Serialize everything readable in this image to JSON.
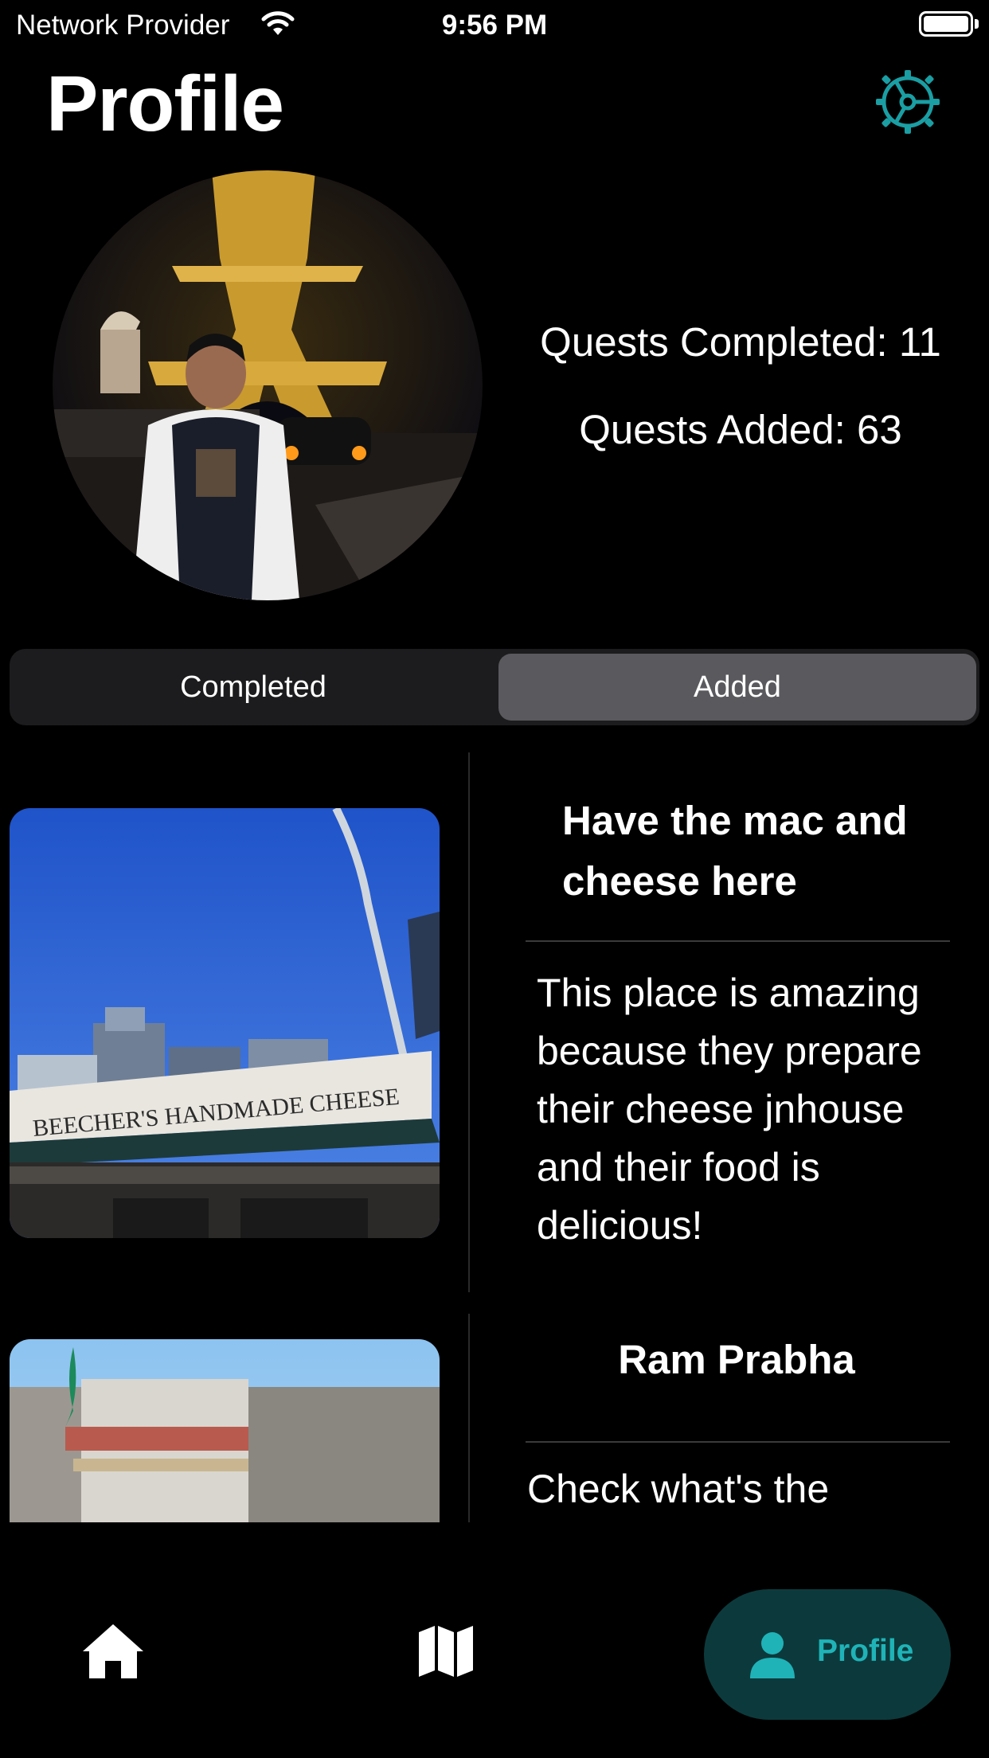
{
  "status_bar": {
    "carrier": "Network Provider",
    "time": "9:56 PM"
  },
  "header": {
    "title": "Profile",
    "settings_icon": "gear-icon",
    "accent_color": "#1a9ea3"
  },
  "profile": {
    "avatar_description_icon": "avatar-photo",
    "quests_completed": "Quests Completed: 11",
    "quests_added": "Quests Added: 63"
  },
  "segments": {
    "items": [
      {
        "label": "Completed",
        "selected": false
      },
      {
        "label": "Added",
        "selected": true
      }
    ]
  },
  "quests": [
    {
      "title": "Have the mac and cheese here",
      "description": "This place is amazing because they prepare their cheese jnhouse and their food is delicious!",
      "image_sign_text": "BEECHER'S HANDMADE CHEESE"
    },
    {
      "title": "Ram Prabha",
      "description": "Check what's the"
    }
  ],
  "tab_bar": {
    "items": [
      {
        "icon": "home-icon"
      },
      {
        "icon": "map-icon"
      },
      {
        "icon": "person-icon",
        "label": "Profile",
        "selected": true
      }
    ],
    "selected_color": "#1fb3b8",
    "selected_bg": "#0c3a3c"
  }
}
